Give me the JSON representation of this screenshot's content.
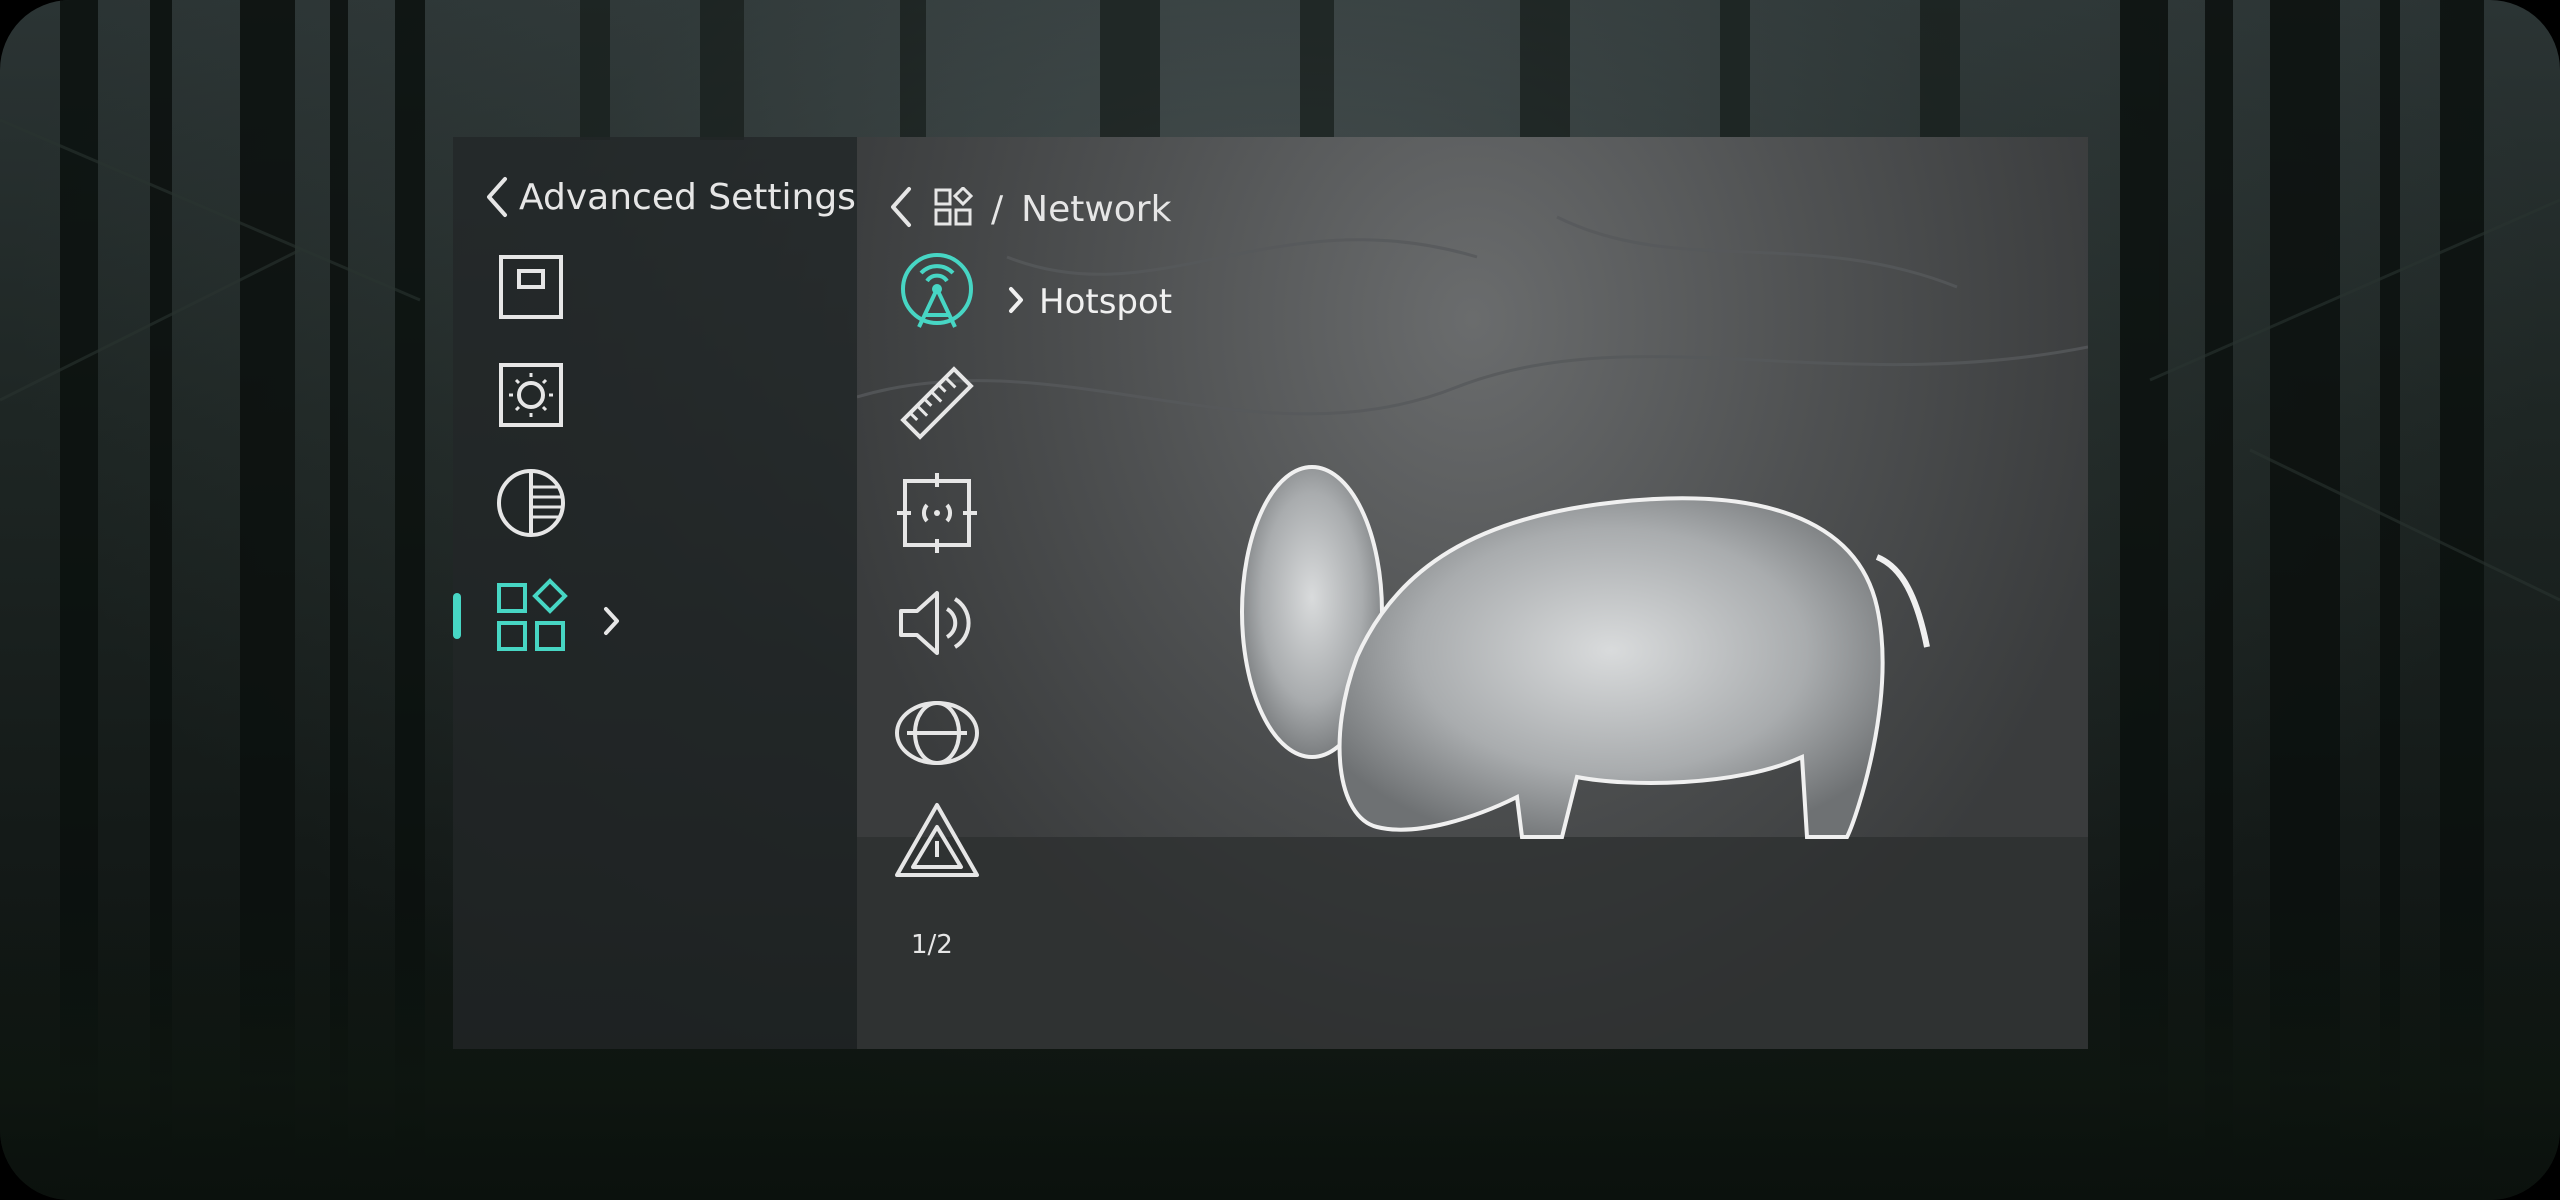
{
  "colors": {
    "accent": "#47d6c4",
    "text": "#e6e6e6"
  },
  "left_panel": {
    "title": "Advanced Settings",
    "items": [
      {
        "icon": "display-frame-icon",
        "active": false
      },
      {
        "icon": "brightness-icon",
        "active": false
      },
      {
        "icon": "contrast-icon",
        "active": false
      },
      {
        "icon": "function-settings-icon",
        "active": true
      }
    ]
  },
  "right_panel": {
    "breadcrumb_icon": "function-settings-icon",
    "breadcrumb_sep": "/",
    "title": "Network",
    "items": [
      {
        "icon": "hotspot-icon",
        "active": true
      },
      {
        "icon": "ruler-icon",
        "active": false
      },
      {
        "icon": "target-focus-icon",
        "active": false
      },
      {
        "icon": "speaker-icon",
        "active": false
      },
      {
        "icon": "globe-icon",
        "active": false
      },
      {
        "icon": "warning-icon",
        "active": false
      }
    ],
    "submenu_label": "Hotspot",
    "pager": "1/2"
  }
}
